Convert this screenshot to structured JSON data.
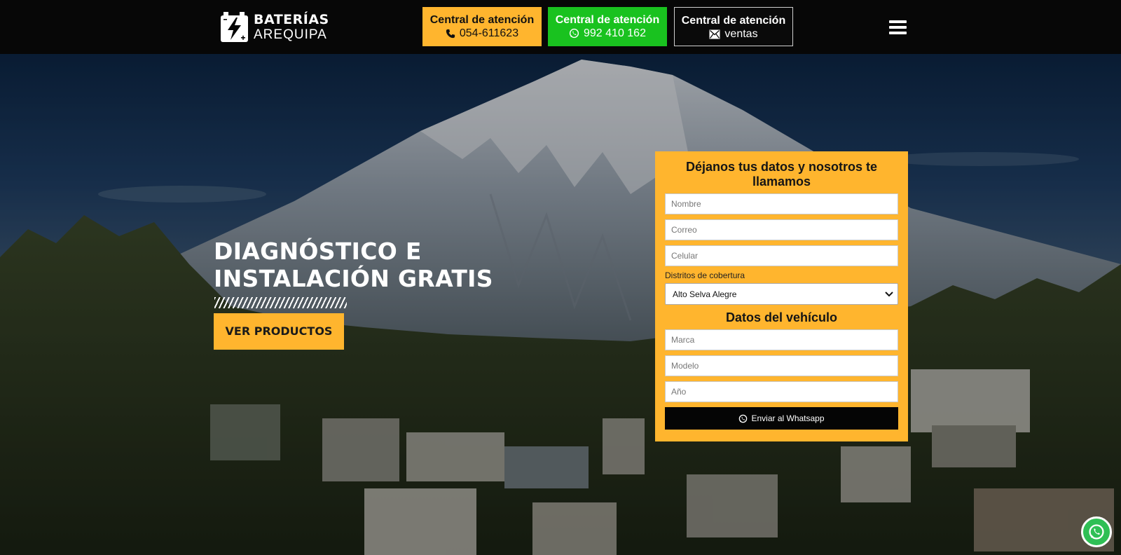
{
  "brand": {
    "name_line1": "BATERÍAS",
    "name_line2": "AREQUIPA"
  },
  "header": {
    "cta_phone": {
      "title": "Central de atención",
      "value": "054-611623",
      "icon": "phone-icon",
      "color": "#ffb52e"
    },
    "cta_whatsapp": {
      "title": "Central de atención",
      "value": "992 410 162",
      "icon": "whatsapp-icon",
      "color": "#19c21f"
    },
    "cta_email": {
      "title": "Central de atención",
      "value": "ventas",
      "icon": "mail-icon",
      "color": "#0a0a0a"
    },
    "menu_icon": "hamburger-icon"
  },
  "hero": {
    "title": "DIAGNÓSTICO E INSTALACIÓN GRATIS",
    "button_label": "VER PRODUCTOS"
  },
  "form": {
    "heading": "Déjanos tus datos y nosotros te llamamos",
    "name_placeholder": "Nombre",
    "email_placeholder": "Correo",
    "phone_placeholder": "Celular",
    "district_label": "Distritos de cobertura",
    "district_selected": "Alto Selva Alegre",
    "vehicle_heading": "Datos del vehículo",
    "brand_placeholder": "Marca",
    "model_placeholder": "Modelo",
    "year_placeholder": "Año",
    "submit_label": "Enviar al Whatsapp",
    "accent": "#ffb52e"
  },
  "floating": {
    "icon": "whatsapp-icon",
    "color": "#2fbf55"
  }
}
